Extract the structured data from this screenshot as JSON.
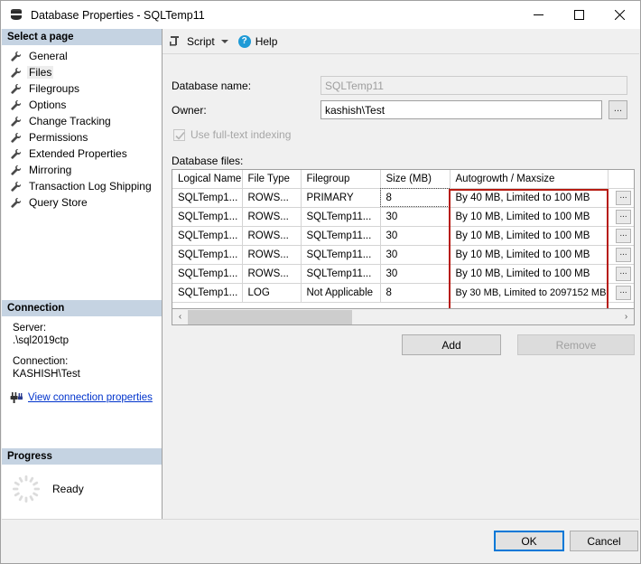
{
  "window": {
    "title": "Database Properties - SQLTemp11",
    "icon": "database-icon",
    "minimize_label": "—",
    "maximize_label": "□",
    "close_label": "✕"
  },
  "sidebar": {
    "select_page_header": "Select a page",
    "pages": [
      {
        "label": "General",
        "selected": false
      },
      {
        "label": "Files",
        "selected": true
      },
      {
        "label": "Filegroups",
        "selected": false
      },
      {
        "label": "Options",
        "selected": false
      },
      {
        "label": "Change Tracking",
        "selected": false
      },
      {
        "label": "Permissions",
        "selected": false
      },
      {
        "label": "Extended Properties",
        "selected": false
      },
      {
        "label": "Mirroring",
        "selected": false
      },
      {
        "label": "Transaction Log Shipping",
        "selected": false
      },
      {
        "label": "Query Store",
        "selected": false
      }
    ],
    "connection_header": "Connection",
    "server_label": "Server:",
    "server_value": ".\\sql2019ctp",
    "connection_label": "Connection:",
    "connection_value": "KASHISH\\Test",
    "view_connection_link": "View connection properties",
    "progress_header": "Progress",
    "progress_status": "Ready"
  },
  "toolbar": {
    "script_label": "Script",
    "help_label": "Help"
  },
  "form": {
    "database_name_label": "Database name:",
    "database_name_value": "SQLTemp11",
    "owner_label": "Owner:",
    "owner_value": "kashish\\Test",
    "owner_browse_label": "...",
    "fulltext_label": "Use full-text indexing",
    "fulltext_checked": true
  },
  "grid": {
    "caption": "Database files:",
    "columns": [
      "Logical Name",
      "File Type",
      "Filegroup",
      "Size (MB)",
      "Autogrowth / Maxsize"
    ],
    "rows": [
      {
        "logical_name": "SQLTemp1...",
        "file_type": "ROWS...",
        "filegroup": "PRIMARY",
        "size_mb": "8",
        "autogrowth": "By 40 MB, Limited to 100 MB",
        "browse_label": "...",
        "size_selected": true
      },
      {
        "logical_name": "SQLTemp1...",
        "file_type": "ROWS...",
        "filegroup": "SQLTemp11...",
        "size_mb": "30",
        "autogrowth": "By 10 MB, Limited to 100 MB",
        "browse_label": "...",
        "size_selected": false
      },
      {
        "logical_name": "SQLTemp1...",
        "file_type": "ROWS...",
        "filegroup": "SQLTemp11...",
        "size_mb": "30",
        "autogrowth": "By 10 MB, Limited to 100 MB",
        "browse_label": "...",
        "size_selected": false
      },
      {
        "logical_name": "SQLTemp1...",
        "file_type": "ROWS...",
        "filegroup": "SQLTemp11...",
        "size_mb": "30",
        "autogrowth": "By 10 MB, Limited to 100 MB",
        "browse_label": "...",
        "size_selected": false
      },
      {
        "logical_name": "SQLTemp1...",
        "file_type": "ROWS...",
        "filegroup": "SQLTemp11...",
        "size_mb": "30",
        "autogrowth": "By 10 MB, Limited to 100 MB",
        "browse_label": "...",
        "size_selected": false
      },
      {
        "logical_name": "SQLTemp1...",
        "file_type": "LOG",
        "filegroup": "Not Applicable",
        "size_mb": "8",
        "autogrowth": "By 30 MB, Limited to 2097152 MB",
        "browse_label": "...",
        "size_selected": false
      }
    ],
    "scroll_left_label": "‹",
    "scroll_right_label": "›"
  },
  "buttons": {
    "add_label": "Add",
    "remove_label": "Remove",
    "remove_enabled": false,
    "ok_label": "OK",
    "cancel_label": "Cancel"
  },
  "colors": {
    "panel_header": "#c5d3e2",
    "highlight_box": "#b71c12",
    "selection": "#aed3ef",
    "link": "#0033cc",
    "focus_border": "#0078d7",
    "help_icon": "#1e9ad6"
  }
}
